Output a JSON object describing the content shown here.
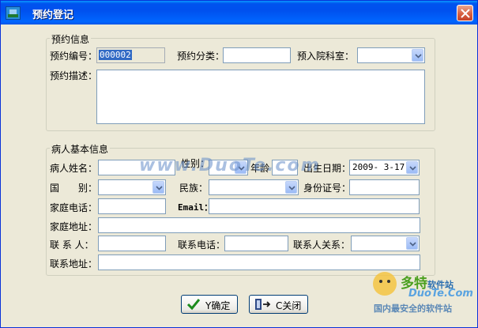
{
  "window": {
    "title": "预约登记"
  },
  "reservation_group": {
    "title": "预约信息",
    "number_label": "预约编号：",
    "number_value": "000002",
    "category_label": "预约分类：",
    "category_value": "",
    "department_label": "预入院科室：",
    "department_value": "",
    "description_label": "预约描述：",
    "description_value": ""
  },
  "patient_group": {
    "title": "病人基本信息",
    "name_label": "病人姓名：",
    "gender_label": "性别：",
    "age_label": "年龄",
    "birthdate_label": "出生日期：",
    "birthdate_value": "2009- 3-17",
    "country_label": "国　　别：",
    "ethnicity_label": "民族：",
    "id_label": "身份证号：",
    "home_phone_label": "家庭电话：",
    "email_label": "Email：",
    "home_address_label": "家庭地址：",
    "contact_label": "联 系 人：",
    "contact_phone_label": "联系电话：",
    "contact_relation_label": "联系人关系：",
    "contact_address_label": "联系地址："
  },
  "buttons": {
    "ok_label": "Y确定",
    "cancel_label": "C关闭"
  },
  "watermark": {
    "text": "www.DuoTe.com",
    "logo_cn": "多特",
    "logo_cn_small": "软件站",
    "logo_en": "DuoTe.Com",
    "logo_sub": "国内最安全的软件站"
  }
}
